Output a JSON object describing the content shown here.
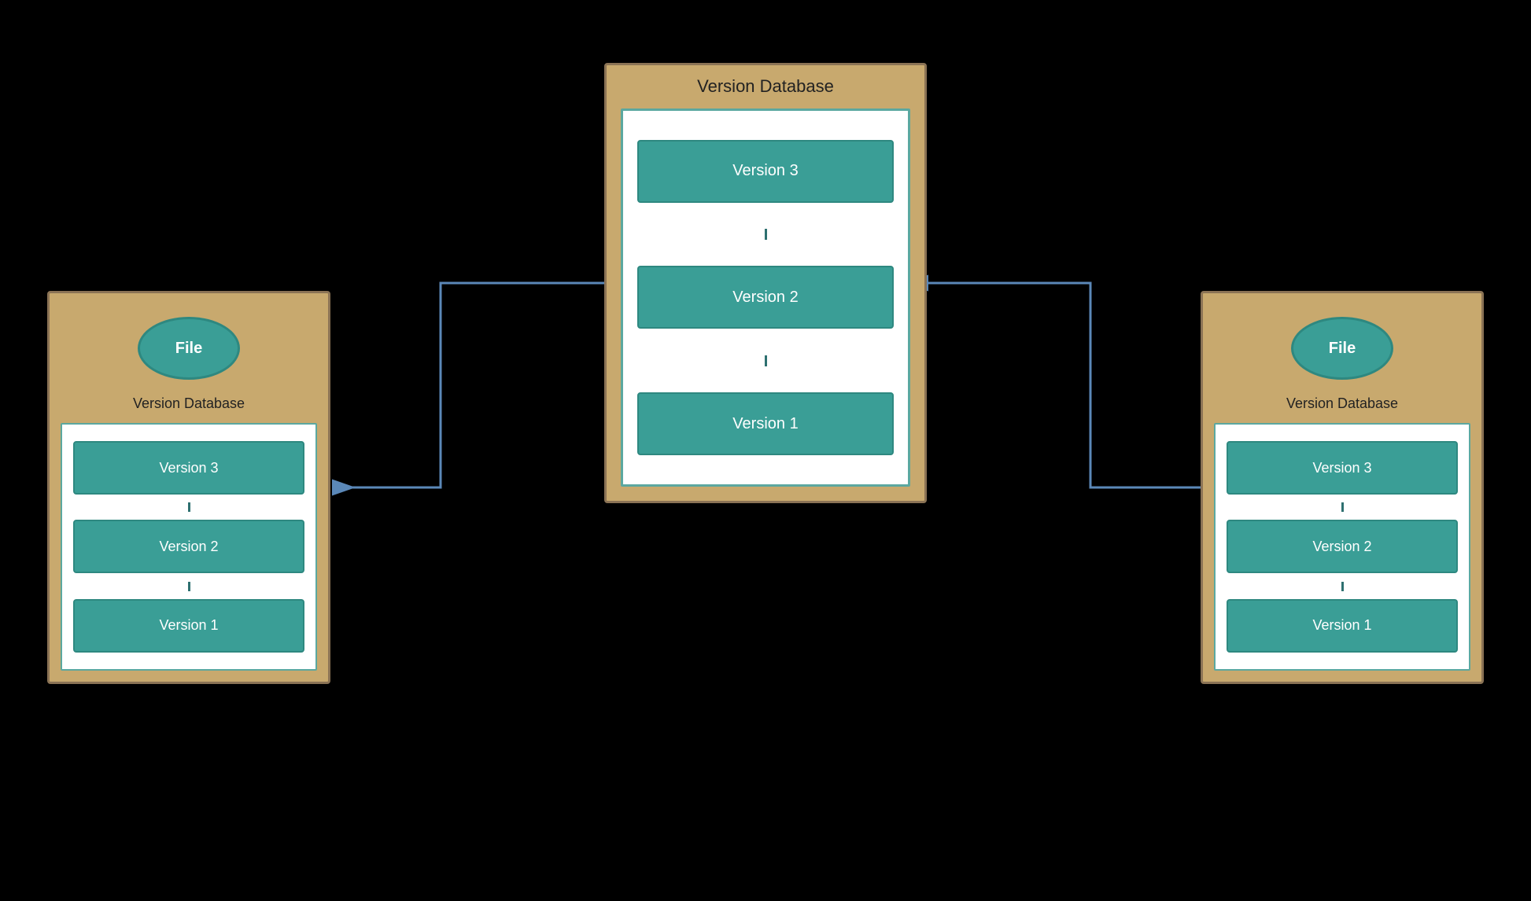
{
  "center": {
    "label": "Version Database",
    "versions": [
      "Version 3",
      "Version 2",
      "Version 1"
    ]
  },
  "left": {
    "label": "Version Database",
    "file_label": "File",
    "versions": [
      "Version 3",
      "Version 2",
      "Version 1"
    ]
  },
  "right": {
    "label": "Version Database",
    "file_label": "File",
    "versions": [
      "Version 3",
      "Version 2",
      "Version 1"
    ]
  },
  "arrows": {
    "color": "#5B88B8"
  }
}
